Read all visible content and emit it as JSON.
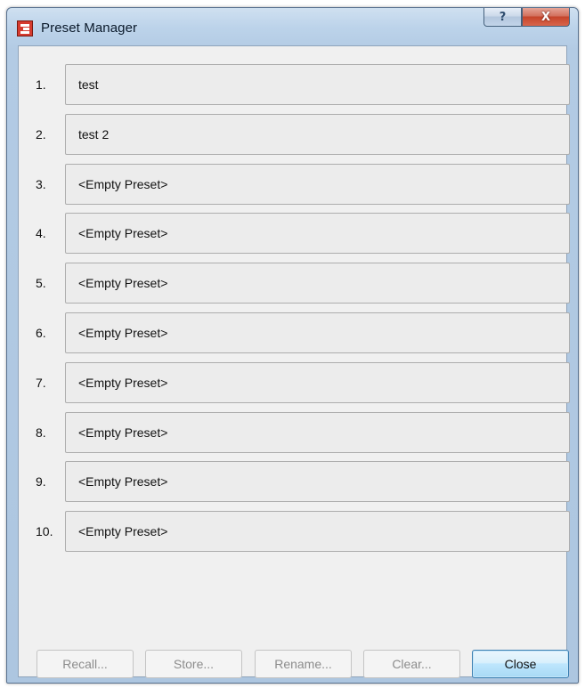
{
  "window": {
    "title": "Preset Manager",
    "help_glyph": "?",
    "close_glyph": "X"
  },
  "presets": [
    {
      "number": "1.",
      "label": "test"
    },
    {
      "number": "2.",
      "label": "test 2"
    },
    {
      "number": "3.",
      "label": "<Empty Preset>"
    },
    {
      "number": "4.",
      "label": "<Empty Preset>"
    },
    {
      "number": "5.",
      "label": "<Empty Preset>"
    },
    {
      "number": "6.",
      "label": "<Empty Preset>"
    },
    {
      "number": "7.",
      "label": "<Empty Preset>"
    },
    {
      "number": "8.",
      "label": "<Empty Preset>"
    },
    {
      "number": "9.",
      "label": "<Empty Preset>"
    },
    {
      "number": "10.",
      "label": "<Empty Preset>"
    }
  ],
  "buttons": {
    "recall": "Recall...",
    "store": "Store...",
    "rename": "Rename...",
    "clear": "Clear...",
    "close": "Close"
  },
  "icons": {
    "app": "preset-manager-app-icon",
    "help": "help-icon",
    "close": "close-icon"
  },
  "colors": {
    "titlebar": "#bcd3ea",
    "close_button": "#c5442a",
    "default_button_border": "#3c7fb1",
    "disabled_text": "#8c8c8c"
  }
}
